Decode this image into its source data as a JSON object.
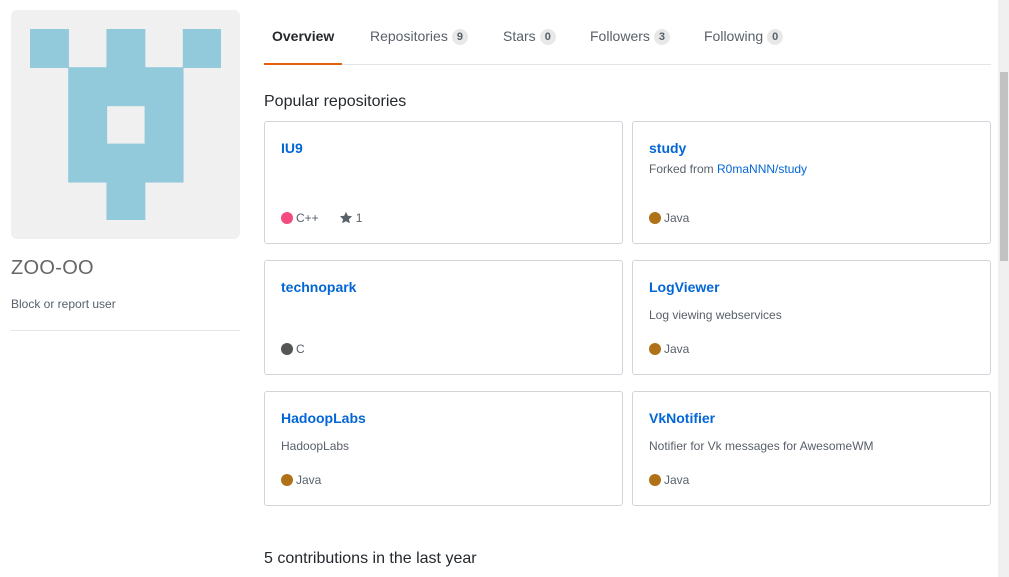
{
  "profile": {
    "username": "ZOO-OO",
    "block_link": "Block or report user",
    "avatar_color": "#92cadc"
  },
  "tabs": [
    {
      "label": "Overview",
      "count": null,
      "selected": true
    },
    {
      "label": "Repositories",
      "count": "9",
      "selected": false
    },
    {
      "label": "Stars",
      "count": "0",
      "selected": false
    },
    {
      "label": "Followers",
      "count": "3",
      "selected": false
    },
    {
      "label": "Following",
      "count": "0",
      "selected": false
    }
  ],
  "popular": {
    "title": "Popular repositories",
    "repos": [
      {
        "name": "IU9",
        "description": "",
        "forked_prefix": "",
        "forked_link": "",
        "language": "C++",
        "language_color": "#f34b7d",
        "stars": "1"
      },
      {
        "name": "study",
        "description": "",
        "forked_prefix": "Forked from ",
        "forked_link": "R0maNNN/study",
        "language": "Java",
        "language_color": "#b07219",
        "stars": ""
      },
      {
        "name": "technopark",
        "description": "",
        "forked_prefix": "",
        "forked_link": "",
        "language": "C",
        "language_color": "#555555",
        "stars": ""
      },
      {
        "name": "LogViewer",
        "description": "Log viewing webservices",
        "forked_prefix": "",
        "forked_link": "",
        "language": "Java",
        "language_color": "#b07219",
        "stars": ""
      },
      {
        "name": "HadoopLabs",
        "description": "HadoopLabs",
        "forked_prefix": "",
        "forked_link": "",
        "language": "Java",
        "language_color": "#b07219",
        "stars": ""
      },
      {
        "name": "VkNotifier",
        "description": "Notifier for Vk messages for AwesomeWM",
        "forked_prefix": "",
        "forked_link": "",
        "language": "Java",
        "language_color": "#b07219",
        "stars": ""
      }
    ]
  },
  "contributions": {
    "title": "5 contributions in the last year"
  },
  "icons": {
    "star": "star-icon",
    "language": "language-dot-icon"
  }
}
